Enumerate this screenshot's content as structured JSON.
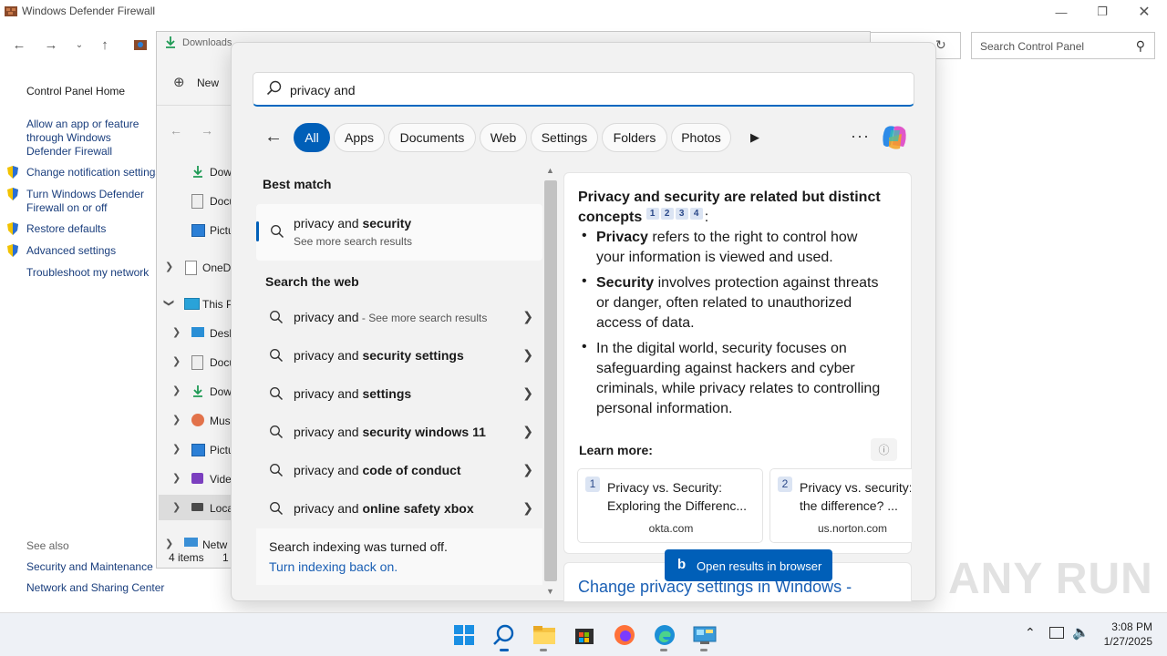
{
  "control_panel": {
    "window_title": "Windows Defender Firewall",
    "search_placeholder": "Search Control Panel",
    "sidebar": {
      "home": "Control Panel Home",
      "links": [
        "Allow an app or feature through Windows Defender Firewall",
        "Change notification settings",
        "Turn Windows Defender Firewall on or off",
        "Restore defaults",
        "Advanced settings",
        "Troubleshoot my network"
      ],
      "see_also_title": "See also",
      "see_also": [
        "Security and Maintenance",
        "Network and Sharing Center"
      ]
    }
  },
  "explorer": {
    "title": "Downloads",
    "new_label": "New",
    "tree": [
      "Dow",
      "Docu",
      "Pictu",
      "OneD",
      "This P",
      "Desk",
      "Docu",
      "Dow",
      "Mus",
      "Pictu",
      "Vide",
      "Loca",
      "Netw"
    ],
    "status": "4 items",
    "status_extra": "1"
  },
  "search": {
    "query": "privacy and",
    "filters": [
      "All",
      "Apps",
      "Documents",
      "Web",
      "Settings",
      "Folders",
      "Photos"
    ],
    "active_filter": "All",
    "best_match_label": "Best match",
    "best_match": {
      "prefix": "privacy and ",
      "bold": "security",
      "sub": "See more search results"
    },
    "web_label": "Search the web",
    "web_results": [
      {
        "prefix": "privacy and",
        "bold": "",
        "suffix": " - See more search results"
      },
      {
        "prefix": "privacy and ",
        "bold": "security settings",
        "suffix": ""
      },
      {
        "prefix": "privacy and ",
        "bold": "settings",
        "suffix": ""
      },
      {
        "prefix": "privacy and ",
        "bold": "security windows 11",
        "suffix": ""
      },
      {
        "prefix": "privacy and ",
        "bold": "code of conduct",
        "suffix": ""
      },
      {
        "prefix": "privacy and ",
        "bold": "online safety xbox",
        "suffix": ""
      }
    ],
    "index_notice": "Search indexing was turned off.",
    "index_link": "Turn indexing back on.",
    "answer": {
      "heading": "Privacy and security are related but distinct concepts",
      "citations": [
        "1",
        "2",
        "3",
        "4"
      ],
      "colon": ":",
      "bullets": [
        {
          "bold": "Privacy",
          "text": " refers to the right to control how your information is viewed and used."
        },
        {
          "bold": "Security",
          "text": " involves protection against threats or danger, often related to unauthorized access of data."
        },
        {
          "bold": "",
          "text": "In the digital world, security focuses on safeguarding against hackers and cyber criminals, while privacy relates to controlling personal information."
        }
      ],
      "learn_more": "Learn more:",
      "sources": [
        {
          "num": "1",
          "title_line1": "Privacy vs. Security:",
          "title_line2": "Exploring the Differenc...",
          "domain": "okta.com"
        },
        {
          "num": "2",
          "title_line1": "Privacy vs. security:",
          "title_line2": "the difference? ...",
          "domain": "us.norton.com"
        }
      ],
      "open_button": "Open results in browser"
    },
    "next_card_title": "Change privacy settings in Windows -"
  },
  "taskbar": {
    "time": "3:08 PM",
    "date": "1/27/2025"
  },
  "watermark": "ANY RUN",
  "colors": {
    "accent": "#005fb8",
    "link": "#1a5fb4"
  }
}
